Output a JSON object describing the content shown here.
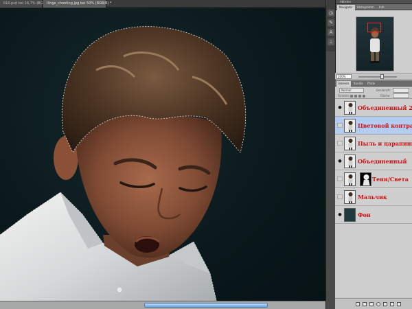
{
  "doc_tabs": [
    {
      "label": "RL6.psd bei 16,7% (RGB/8) *",
      "close": "×"
    },
    {
      "label": "Ilinge_chooting.jpg bei 50% (RGB/8) *",
      "close": "×"
    }
  ],
  "navigator": {
    "panel_title": "Ablisten",
    "tabs": [
      "Navigator",
      "Histogramm",
      "Info"
    ],
    "zoom": "200%"
  },
  "layers_panel": {
    "tabs": [
      "Ebenen",
      "Kanäle",
      "Pfade"
    ],
    "blend_mode": "Normal",
    "opacity_label": "Deckkraft:",
    "fill_label": "Fläche:",
    "lock_label": "Fixieren:",
    "layers": [
      {
        "name": "Объединенный 2",
        "visible": true,
        "selected": false,
        "eye": "●"
      },
      {
        "name": "Цветовой контраст",
        "visible": false,
        "selected": true,
        "eye": ""
      },
      {
        "name": "Пыль и царапины",
        "visible": false,
        "selected": false,
        "eye": ""
      },
      {
        "name": "Объединенный",
        "visible": true,
        "selected": false,
        "eye": "●"
      },
      {
        "name": "Тени/Света",
        "visible": false,
        "selected": false,
        "eye": ""
      },
      {
        "name": "Мальчик",
        "visible": false,
        "selected": false,
        "eye": ""
      },
      {
        "name": "Фон",
        "visible": true,
        "selected": false,
        "eye": "●"
      }
    ]
  },
  "colors": {
    "layer_name": "#cc1212",
    "selected_row": "#b3ccf0",
    "canvas_bg": "#0a181b",
    "nav_frame": "#e02a2a"
  },
  "icons": {
    "tools": [
      "history-icon",
      "brush-icon",
      "type-icon",
      "stamp-icon"
    ],
    "footer": [
      "link-icon",
      "fx-icon",
      "mask-icon",
      "adjustment-icon",
      "group-icon",
      "new-layer-icon",
      "trash-icon"
    ]
  }
}
